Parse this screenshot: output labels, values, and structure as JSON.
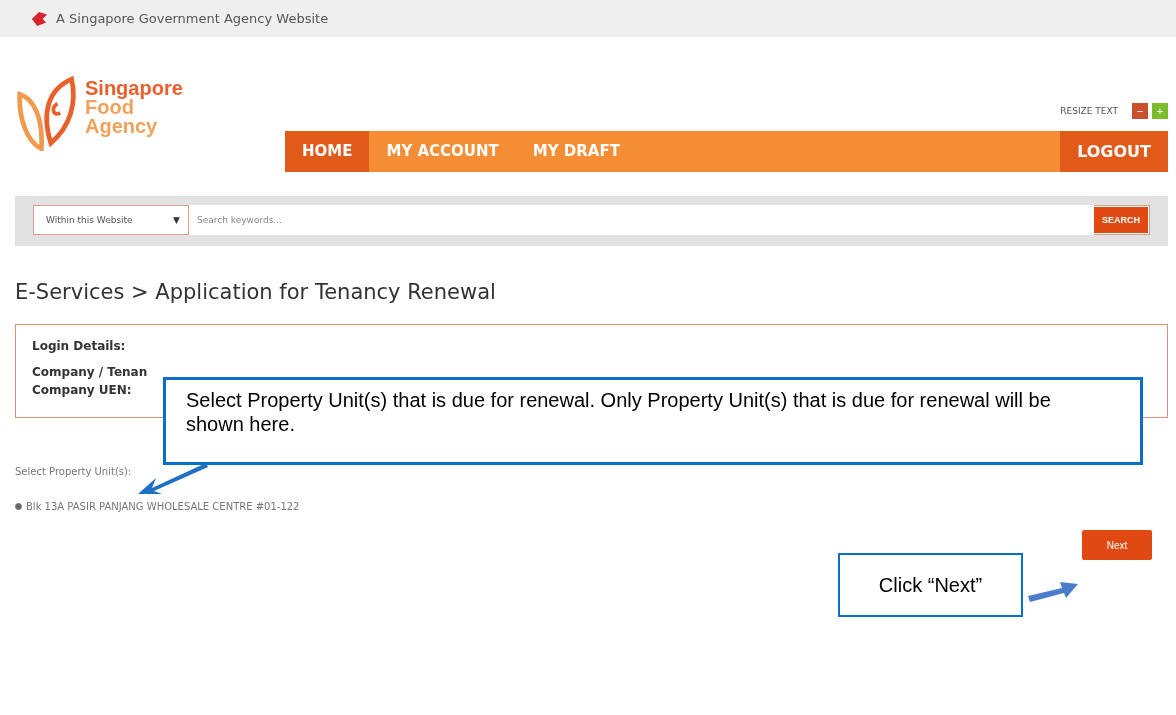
{
  "gov_banner": {
    "text": "A Singapore Government Agency Website"
  },
  "logo": {
    "lines": [
      "Singapore",
      "Food",
      "Agency"
    ]
  },
  "resize_text": {
    "label": "RESIZE TEXT",
    "decrease": "−",
    "increase": "+"
  },
  "nav": {
    "items": [
      {
        "label": "HOME",
        "selected": true
      },
      {
        "label": "MY ACCOUNT",
        "selected": false
      },
      {
        "label": "MY DRAFT",
        "selected": false
      }
    ],
    "logout": "LOGOUT"
  },
  "search": {
    "scope": "Within this Website",
    "caret": "▼",
    "placeholder": "Search keywords...",
    "button": "SEARCH"
  },
  "breadcrumb": "E-Services > Application for Tenancy Renewal",
  "login_details": {
    "title": "Login Details:",
    "fields": [
      "Company / Tenan",
      "Company UEN:"
    ]
  },
  "property_select": {
    "label": "Select Property Unit(s):",
    "options": [
      {
        "label": "Blk 13A PASIR PANJANG WHOLESALE CENTRE #01-122",
        "checked": true
      }
    ]
  },
  "next_button": "Next",
  "callouts": [
    {
      "text": "Select Property Unit(s) that is due for renewal. Only Property Unit(s) that is due for renewal will be shown here."
    },
    {
      "text": "Click “Next”"
    }
  ]
}
